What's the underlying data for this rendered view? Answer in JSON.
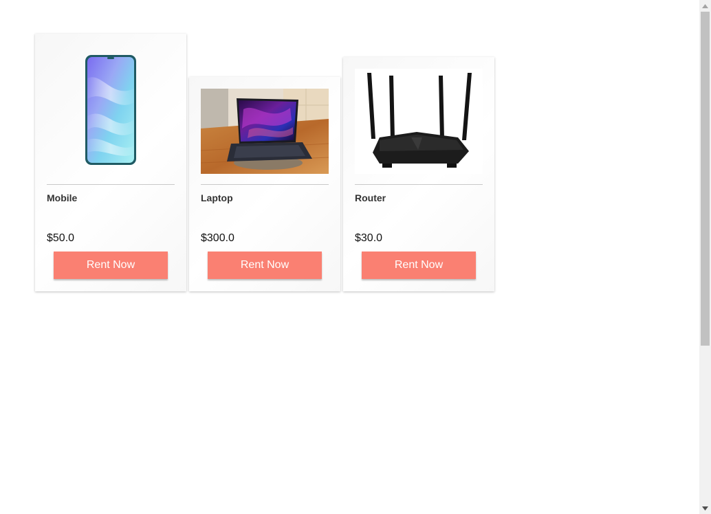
{
  "products": [
    {
      "name": "Mobile",
      "price": "$50.0",
      "button_label": "Rent Now"
    },
    {
      "name": "Laptop",
      "price": "$300.0",
      "button_label": "Rent Now"
    },
    {
      "name": "Router",
      "price": "$30.0",
      "button_label": "Rent Now"
    }
  ],
  "colors": {
    "button": "#fa8072",
    "button_text": "#ffffff",
    "card_background": "#f7f7f7"
  }
}
